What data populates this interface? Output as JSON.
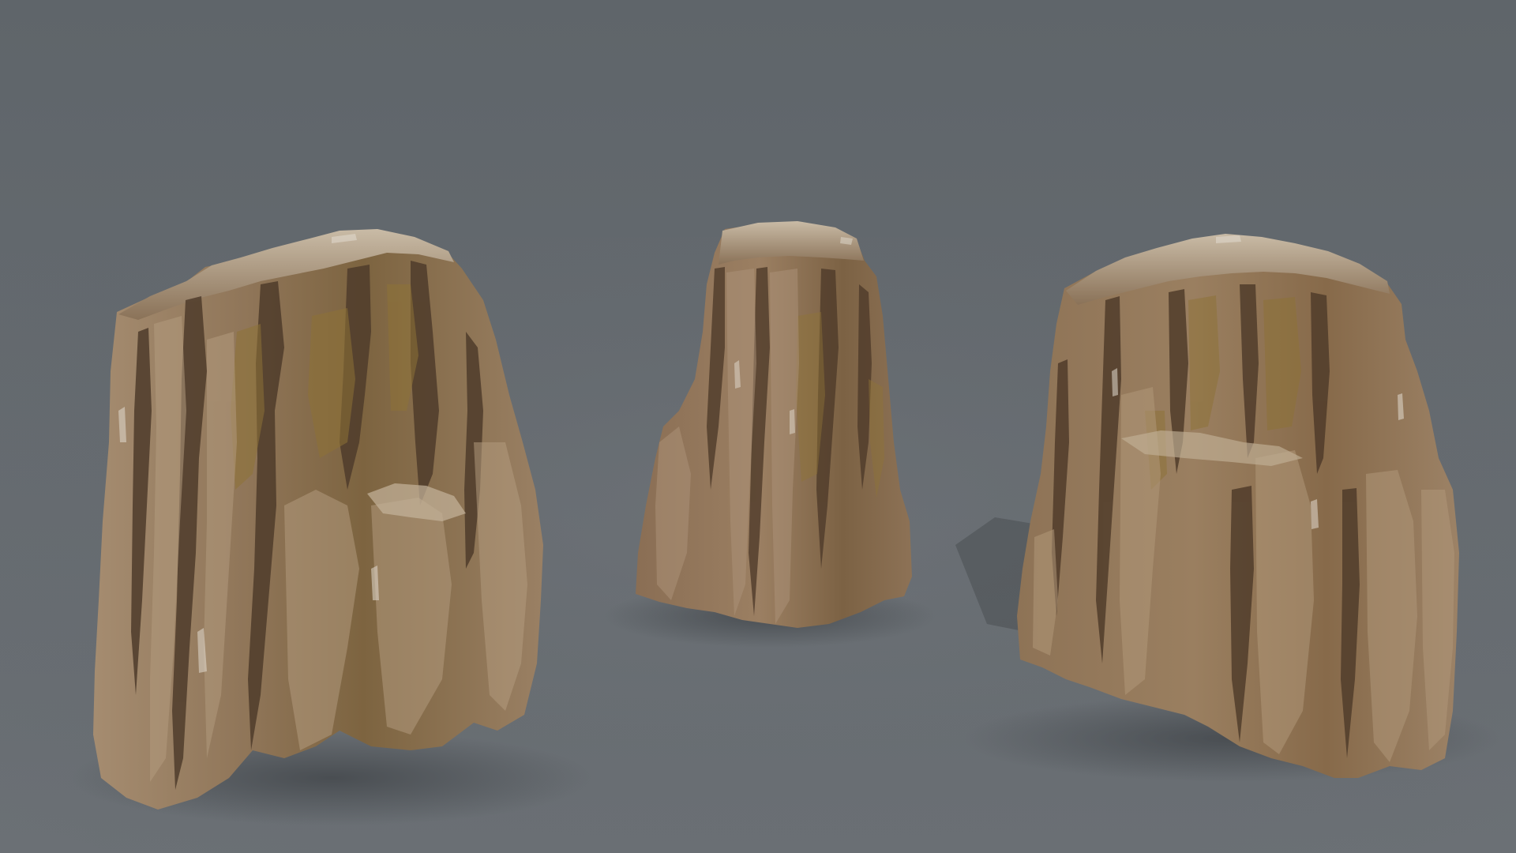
{
  "scene": {
    "description_shown": "",
    "background": {
      "top_color": "#5f656a",
      "bottom_color": "#6b7075",
      "floor_shade": "#676c70"
    },
    "objects": [
      {
        "name": "rock-formation-left",
        "kind": "sandstone rock pillar cluster"
      },
      {
        "name": "rock-formation-center",
        "kind": "sandstone rock pillar"
      },
      {
        "name": "rock-formation-right",
        "kind": "sandstone rock pillar cluster"
      }
    ],
    "palette": {
      "rock_light": "#b59f83",
      "rock_mid": "#8f7558",
      "rock_dark": "#5a4431",
      "rock_shadow": "#3d2e22",
      "rock_ochre": "#9c7f3c",
      "rock_highlight": "#d6cdbf",
      "ground_shadow": "#4e5357"
    }
  }
}
